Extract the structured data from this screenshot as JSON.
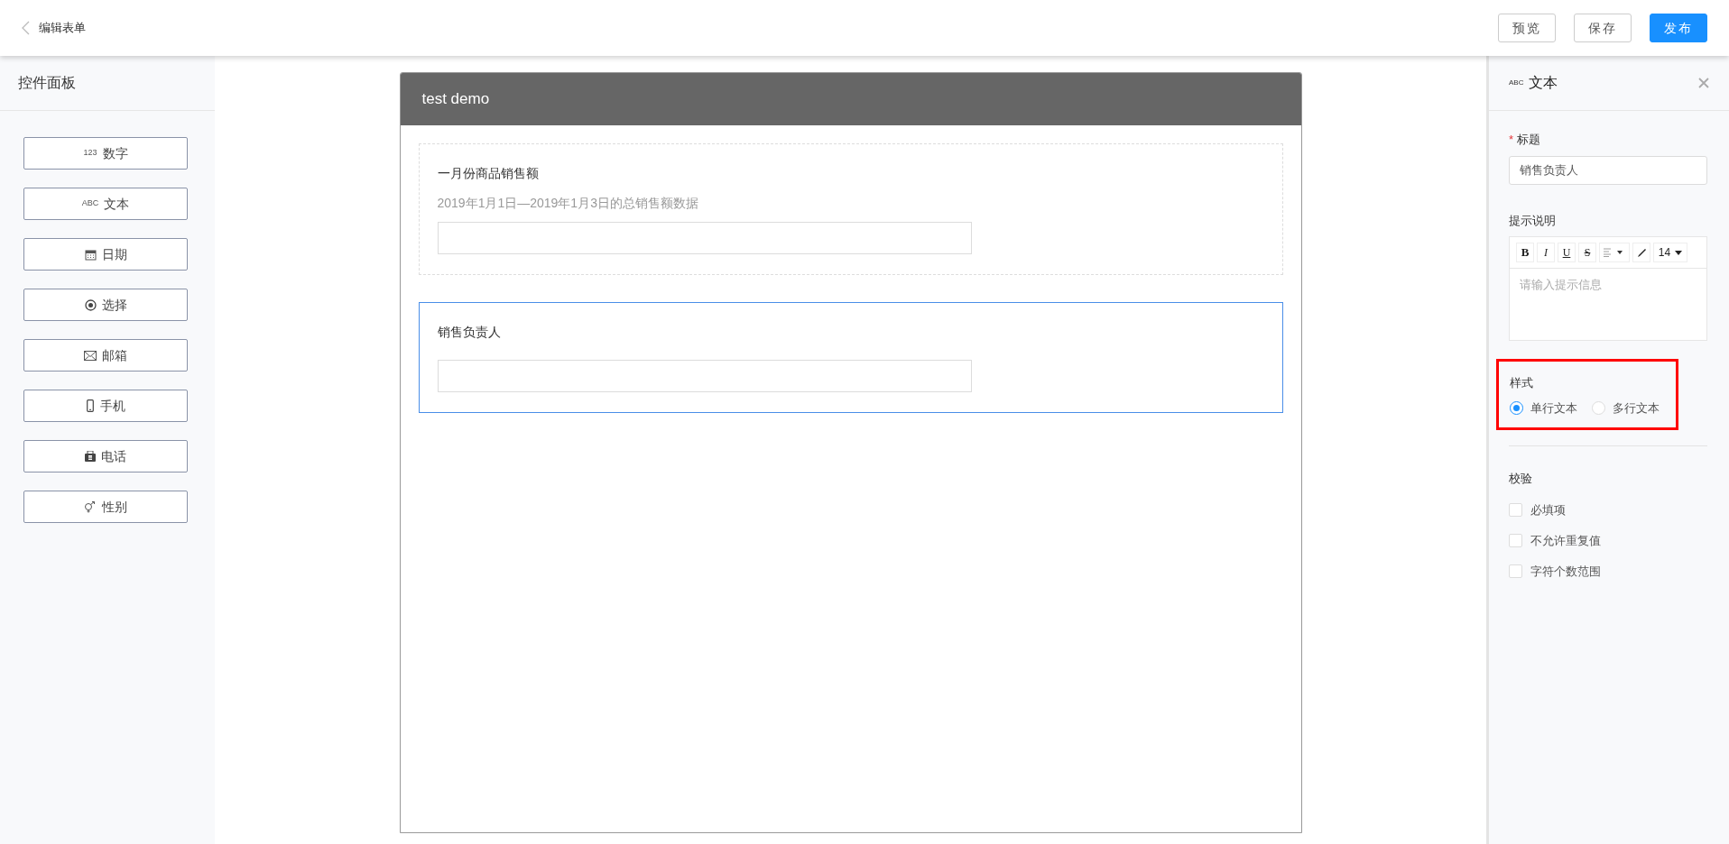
{
  "header": {
    "title": "编辑表单",
    "buttons": [
      {
        "label": "预览",
        "kind": "default"
      },
      {
        "label": "保存",
        "kind": "default"
      },
      {
        "label": "发布",
        "kind": "primary"
      }
    ]
  },
  "control_panel": {
    "title": "控件面板",
    "items": [
      {
        "label": "数字",
        "kind": "number",
        "icon_text": "123"
      },
      {
        "label": "文本",
        "kind": "text",
        "icon_text": "ABC"
      },
      {
        "label": "日期",
        "kind": "date"
      },
      {
        "label": "选择",
        "kind": "select"
      },
      {
        "label": "邮箱",
        "kind": "email"
      },
      {
        "label": "手机",
        "kind": "mobile"
      },
      {
        "label": "电话",
        "kind": "phone"
      },
      {
        "label": "性别",
        "kind": "gender"
      }
    ]
  },
  "form": {
    "title": "test demo",
    "fields": [
      {
        "label": "一月份商品销售额",
        "hint": "2019年1月1日—2019年1月3日的总销售额数据",
        "selected": false
      },
      {
        "label": "销售负责人",
        "selected": true
      }
    ]
  },
  "properties": {
    "icon_text": "ABC",
    "title": "文本",
    "title_field": {
      "required_mark": "*",
      "label": "标题",
      "value": "销售负责人"
    },
    "hint_field": {
      "label": "提示说明",
      "toolbar": [
        {
          "kind": "bold",
          "text": "B"
        },
        {
          "kind": "italic",
          "text": "I"
        },
        {
          "kind": "underline",
          "text": "U"
        },
        {
          "kind": "strike",
          "text": "S"
        },
        {
          "kind": "align"
        },
        {
          "kind": "color"
        },
        {
          "kind": "size",
          "text": "14"
        }
      ],
      "placeholder": "请输入提示信息"
    },
    "style": {
      "label": "样式",
      "highlighted": true,
      "options": [
        {
          "label": "单行文本",
          "selected": true
        },
        {
          "label": "多行文本",
          "selected": false
        }
      ]
    },
    "validation": {
      "label": "校验",
      "options": [
        {
          "label": "必填项",
          "checked": false
        },
        {
          "label": "不允许重复值",
          "checked": false
        },
        {
          "label": "字符个数范围",
          "checked": false
        }
      ]
    }
  }
}
